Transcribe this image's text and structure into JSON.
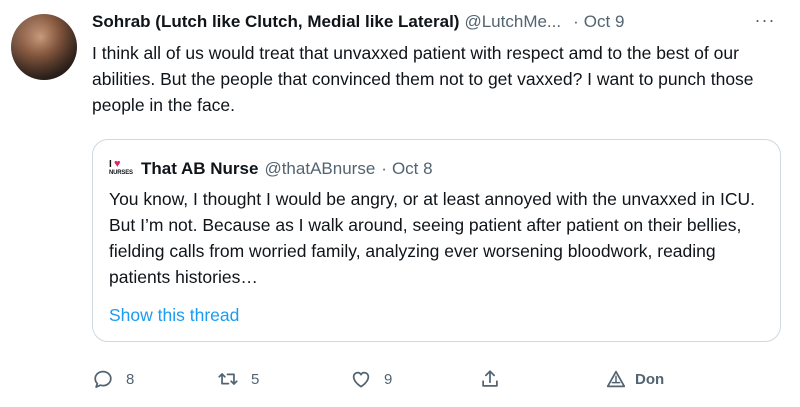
{
  "author": {
    "name": "Sohrab (Lutch like Clutch, Medial like Lateral)",
    "handle": "@LutchMe...",
    "separator": "·",
    "date": "Oct 9"
  },
  "more_label": "···",
  "body": "I think all of us would treat that unvaxxed patient with respect amd to the best of our abilities. But the people that convinced them not to get vaxxed? I want to punch those people  in the face.",
  "quote": {
    "name": "That AB Nurse",
    "handle": "@thatABnurse",
    "separator": "·",
    "date": "Oct 8",
    "icon_text": "I NURSES",
    "text": "You know, I thought I would be angry, or at least annoyed with the unvaxxed in ICU. But I’m not. Because as I walk around, seeing patient after patient on their bellies, fielding calls from worried family, analyzing ever worsening bloodwork, reading patients histories…",
    "show_thread": "Show this thread"
  },
  "actions": {
    "reply_count": "8",
    "retweet_count": "5",
    "like_count": "9",
    "don_label": "Don"
  },
  "colors": {
    "text": "#0f1419",
    "secondary": "#536471",
    "link": "#1d9bf0",
    "border": "#cfd9de"
  }
}
